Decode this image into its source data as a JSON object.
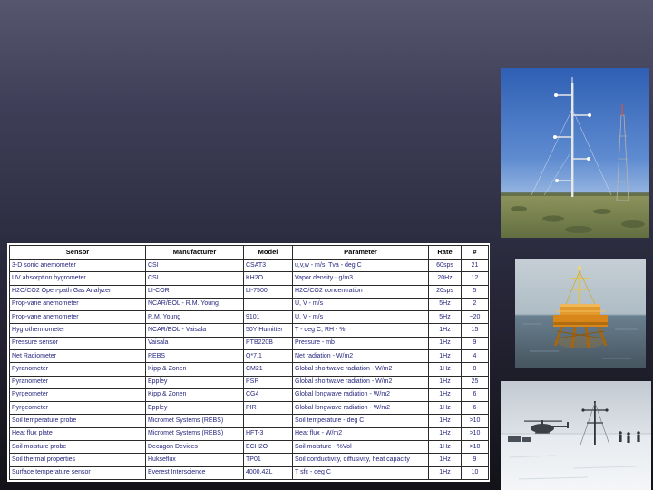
{
  "slide": {
    "background_top": "#56566e",
    "background_bottom": "#121218"
  },
  "table": {
    "type": "table",
    "text_color": "#26267e",
    "header_color": "#000000",
    "columns": [
      "Sensor",
      "Manufacturer",
      "Model",
      "Parameter",
      "Rate",
      "#"
    ],
    "rows": [
      [
        "3-D sonic anemometer",
        "CSI",
        "CSAT3",
        "u,v,w - m/s; Tva - deg C",
        "60sps",
        "21"
      ],
      [
        "UV absorption hygrometer",
        "CSI",
        "KH2O",
        "Vapor density - g/m3",
        "20Hz",
        "12"
      ],
      [
        "H2O/CO2 Open-path Gas Analyzer",
        "LI-COR",
        "LI-7500",
        "H2O/CO2 concentration",
        "20sps",
        "5"
      ],
      [
        "Prop-vane anemometer",
        "NCAR/EOL - R.M. Young",
        "",
        "U, V - m/s",
        "5Hz",
        "2"
      ],
      [
        "Prop-vane anemometer",
        "R.M. Young",
        "9101",
        "U, V - m/s",
        "5Hz",
        "~20"
      ],
      [
        "Hygrothermometer",
        "NCAR/EOL - Vaisala",
        "50Y Humitter",
        "T - deg C; RH - %",
        "1Hz",
        "15"
      ],
      [
        "Pressure sensor",
        "Vaisala",
        "PTB220B",
        "Pressure - mb",
        "1Hz",
        "9"
      ],
      [
        "Net Radiometer",
        "REBS",
        "Q*7.1",
        "Net radiation - W/m2",
        "1Hz",
        "4"
      ],
      [
        "Pyranometer",
        "Kipp & Zonen",
        "CM21",
        "Global shortwave radiation - W/m2",
        "1Hz",
        "8"
      ],
      [
        "Pyranometer",
        "Eppley",
        "PSP",
        "Global shortwave radiation - W/m2",
        "1Hz",
        "25"
      ],
      [
        "Pyrgeometer",
        "Kipp & Zonen",
        "CG4",
        "Global longwave radiation - W/m2",
        "1Hz",
        "6"
      ],
      [
        "Pyrgeometer",
        "Eppley",
        "PIR",
        "Global longwave radiation - W/m2",
        "1Hz",
        "6"
      ],
      [
        "Soil temperature probe",
        "Micromet Systems (REBS)",
        "",
        "Soil temperature - deg C",
        "1Hz",
        ">10"
      ],
      [
        "Heat flux plate",
        "Micromet Systems (REBS)",
        "HFT-3",
        "Heat flux - W/m2",
        "1Hz",
        ">10"
      ],
      [
        "Soil moisture probe",
        "Decagon Devices",
        "ECH2O",
        "Soil moisture - %Vol",
        "1Hz",
        ">10"
      ],
      [
        "Soil thermal properties",
        "Hukseflux",
        "TP01",
        "Soil conductivity, diffusivity, heat capacity",
        "1Hz",
        "9"
      ],
      [
        "Surface temperature sensor",
        "Everest Interscience",
        "4000.4ZL",
        "T sfc - deg C",
        "1Hz",
        "10"
      ]
    ]
  },
  "photos": [
    {
      "name": "flux-tower-grassland",
      "sky": "#3f6fbe",
      "ground": "#7d824f"
    },
    {
      "name": "ocean-platform-tower",
      "sky": "#c2ccd2",
      "sea": "#5a6f80",
      "structure": "#d8861a"
    },
    {
      "name": "polar-snow-field-site",
      "sky": "#c6cdd4",
      "snow": "#edf0f2"
    }
  ]
}
